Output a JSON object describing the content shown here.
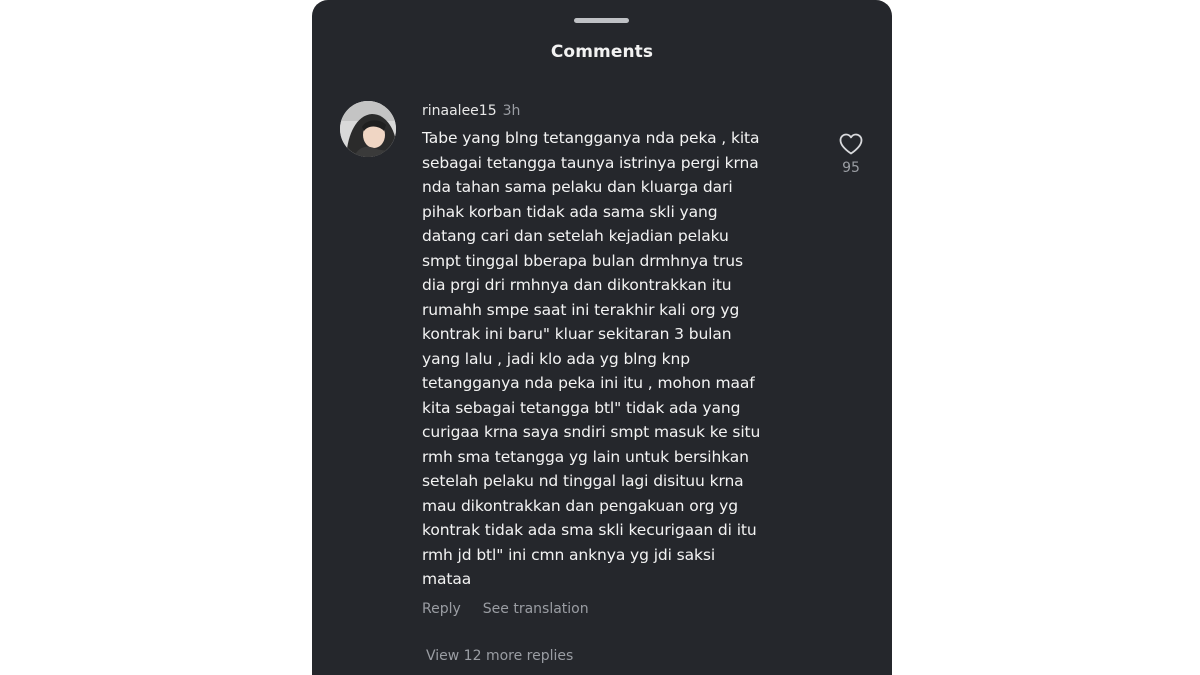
{
  "sheet": {
    "title": "Comments"
  },
  "comment": {
    "username": "rinaalee15",
    "time": "3h",
    "lines": [
      "Tabe yang blng tetangganya nda peka , kita",
      "sebagai tetangga taunya istrinya pergi krna",
      "nda tahan sama pelaku dan kluarga dari",
      "pihak korban tidak ada sama skli yang",
      "datang cari dan setelah kejadian pelaku",
      "smpt tinggal bberapa bulan drmhnya trus",
      "dia prgi dri rmhnya dan dikontrakkan itu",
      "rumahh smpe saat ini terakhir kali org yg",
      "kontrak ini baru\" kluar sekitaran 3 bulan",
      "yang lalu , jadi klo ada yg blng knp",
      "tetangganya nda peka ini itu , mohon maaf",
      "kita sebagai tetangga btl\" tidak ada yang",
      "curigaa krna saya sndiri smpt masuk ke situ",
      "rmh sma tetangga yg lain untuk bersihkan",
      "setelah pelaku nd tinggal lagi disituu krna",
      "mau dikontrakkan dan pengakuan org yg",
      "kontrak tidak ada sma skli kecurigaan di itu",
      "rmh jd btl\" ini cmn anknya yg jdi saksi",
      "mataa"
    ],
    "reply_label": "Reply",
    "translate_label": "See translation",
    "like_icon": "heart-icon",
    "like_count": "95",
    "more_replies_label": "View 12 more replies"
  },
  "colors": {
    "sheet_background": "#25272c",
    "primary_text": "#f3f3f3",
    "secondary_text": "#9a9da3"
  }
}
